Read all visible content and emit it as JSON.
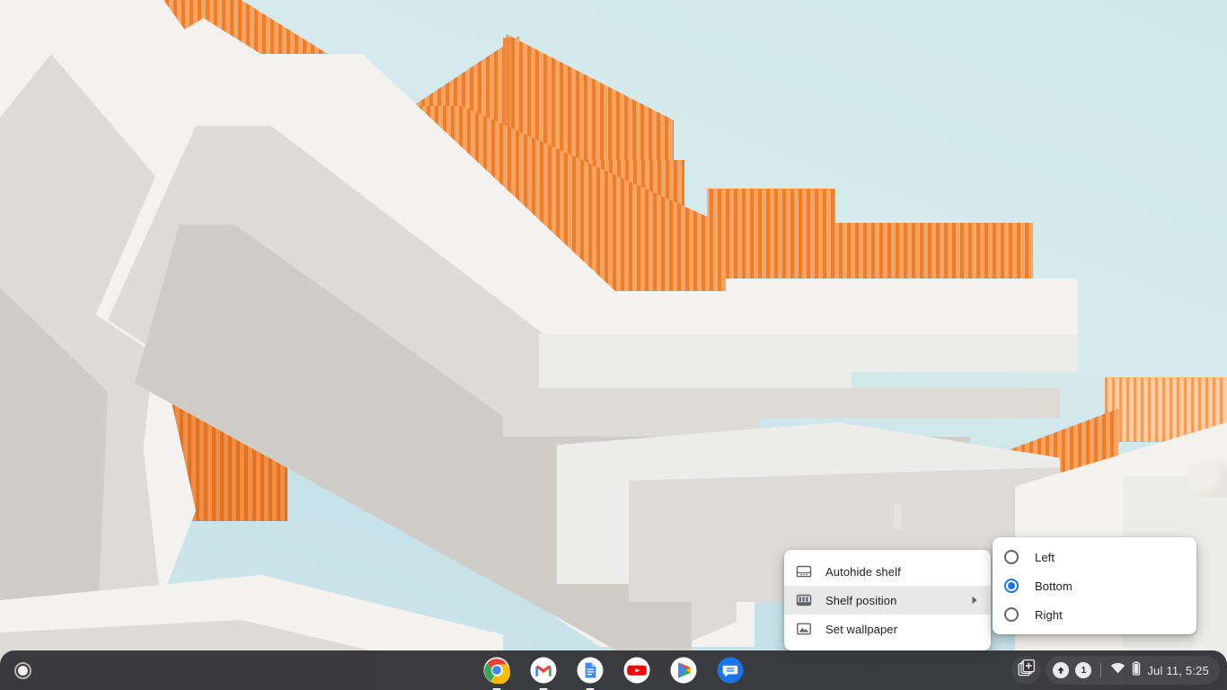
{
  "desktop": {
    "wallpaper_description": "Architectural photo of white concrete stairways with bright orange metal railings against a pale blue sky",
    "wallpaper_colors": {
      "sky": "#cfe7ea",
      "railing_orange": "#f5873a",
      "railing_dark_orange": "#e2701d",
      "railing_light_orange": "#f9a463",
      "concrete_white": "#f4f2ef",
      "concrete_shadow": "#dedbd7"
    }
  },
  "context_menu": {
    "name": "desktop-context-menu",
    "items": [
      {
        "label": "Autohide shelf",
        "icon": "autohide-shelf-icon",
        "highlighted": false,
        "has_submenu": false
      },
      {
        "label": "Shelf position",
        "icon": "shelf-position-icon",
        "highlighted": true,
        "has_submenu": true
      },
      {
        "label": "Set wallpaper",
        "icon": "set-wallpaper-icon",
        "highlighted": false,
        "has_submenu": false
      }
    ]
  },
  "shelf_position_submenu": {
    "name": "shelf-position-submenu",
    "options": [
      {
        "label": "Left",
        "selected": false
      },
      {
        "label": "Bottom",
        "selected": true
      },
      {
        "label": "Right",
        "selected": false
      }
    ],
    "accent_color": "#1a73e8"
  },
  "shelf": {
    "background_color": "#303034",
    "launcher": {
      "icon": "launcher-icon",
      "label": "Launcher"
    },
    "apps": [
      {
        "name": "chrome",
        "label": "Google Chrome",
        "running": true
      },
      {
        "name": "gmail",
        "label": "Gmail",
        "running": true
      },
      {
        "name": "docs",
        "label": "Google Docs",
        "running": true
      },
      {
        "name": "youtube",
        "label": "YouTube",
        "running": false
      },
      {
        "name": "play-store",
        "label": "Play Store",
        "running": false
      },
      {
        "name": "messages",
        "label": "Messages",
        "running": false
      }
    ],
    "status": {
      "phone_hub_icon": "phone-hub-icon",
      "update_badge_icon": "update-available-icon",
      "notification_count": "1",
      "wifi_icon": "wifi-icon",
      "battery_icon": "battery-icon",
      "clock": "Jul 11, 5:25"
    }
  }
}
